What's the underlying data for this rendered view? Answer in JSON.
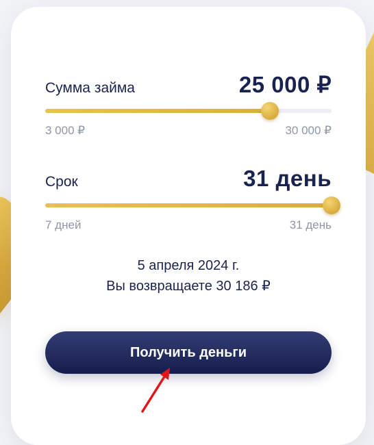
{
  "amount": {
    "label": "Сумма займа",
    "value_text": "25 000 ₽",
    "min_label": "3 000 ₽",
    "max_label": "30 000 ₽",
    "fraction": 0.7857
  },
  "term": {
    "label": "Срок",
    "value_text": "31 день",
    "min_label": "7 дней",
    "max_label": "31 день",
    "fraction": 1.0
  },
  "summary": {
    "date": "5 апреля 2024 г.",
    "return_text": "Вы возвращаете 30 186 ₽"
  },
  "cta": {
    "label": "Получить деньги"
  },
  "colors": {
    "accent": "#dcae42",
    "primary": "#1a2350",
    "muted": "#8f96a8",
    "arrow": "#e0161b"
  }
}
